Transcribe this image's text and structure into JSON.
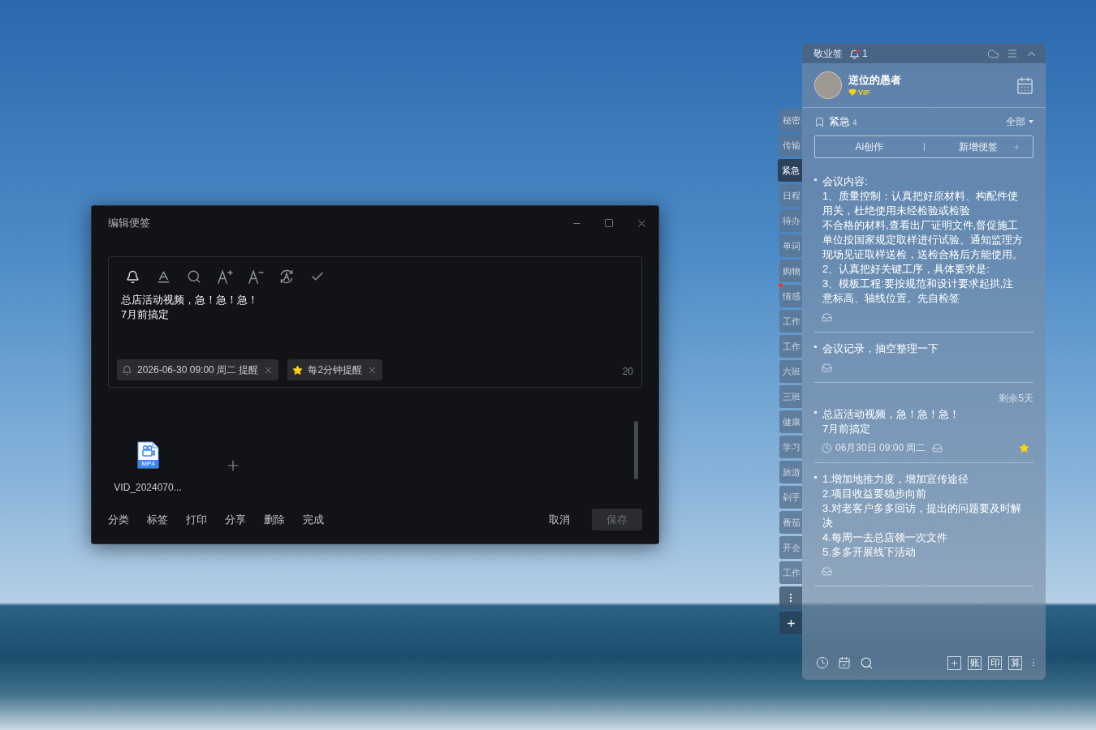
{
  "editor": {
    "title": "编辑便签",
    "content": "总店活动视频，急！急！急！\n7月前搞定",
    "chips": [
      {
        "kind": "reminder",
        "label": "2026-06-30 09:00 周二 提醒"
      },
      {
        "kind": "repeat",
        "label": "每2分钟提醒"
      }
    ],
    "char_count": "20",
    "attachments": [
      {
        "type": "MP4",
        "name": "VID_2024070..."
      }
    ],
    "actions": [
      "分类",
      "标签",
      "打印",
      "分享",
      "删除",
      "完成"
    ],
    "cancel": "取消",
    "save": {
      "label": "保存",
      "disabled": true
    }
  },
  "category_tabs": [
    {
      "label": "秘密",
      "selected": false,
      "alert": false
    },
    {
      "label": "传输",
      "selected": false,
      "alert": false
    },
    {
      "label": "紧急",
      "selected": true,
      "alert": false
    },
    {
      "label": "日程",
      "selected": false,
      "alert": false
    },
    {
      "label": "待办",
      "selected": false,
      "alert": false
    },
    {
      "label": "单词",
      "selected": false,
      "alert": false
    },
    {
      "label": "购物",
      "selected": false,
      "alert": false
    },
    {
      "label": "情感",
      "selected": false,
      "alert": true
    },
    {
      "label": "工作",
      "selected": false,
      "alert": false
    },
    {
      "label": "工作",
      "selected": false,
      "alert": false
    },
    {
      "label": "六班",
      "selected": false,
      "alert": false
    },
    {
      "label": "三班",
      "selected": false,
      "alert": false
    },
    {
      "label": "健康",
      "selected": false,
      "alert": false
    },
    {
      "label": "学习",
      "selected": false,
      "alert": false
    },
    {
      "label": "旅游",
      "selected": false,
      "alert": false
    },
    {
      "label": "剁手",
      "selected": false,
      "alert": false
    },
    {
      "label": "番茄",
      "selected": false,
      "alert": false
    },
    {
      "label": "开会",
      "selected": false,
      "alert": false
    },
    {
      "label": "工作",
      "selected": false,
      "alert": false
    }
  ],
  "notes_panel": {
    "app_name": "敬业签",
    "notification_count": "1",
    "user": {
      "name": "逆位的愚者",
      "badge": "VIP"
    },
    "category": {
      "name": "紧急",
      "count": "4",
      "filter": "全部"
    },
    "buttons": [
      "Ai创作",
      "新增便签"
    ],
    "notes": [
      {
        "lines": [
          "会议内容:",
          "1、质量控制：认真把好原材料、构配件使用关，杜绝使用未经检验或检验",
          "不合格的材料,查看出厂证明文件,督促施工单位按国家规定取样进行试验。通知监理方现场见证取样送检，送检合格后方能使用。",
          "2、认真把好关键工序，具体要求是:",
          "3、模板工程:要按规范和设计要求起拱,注意标高、轴线位置。先自检签"
        ],
        "starred": false
      },
      {
        "lines": [
          "会议记录，抽空整理一下"
        ],
        "starred": false
      },
      {
        "remaining": "剩余5天",
        "lines": [
          "总店活动视频，急！急！急！",
          "7月前搞定"
        ],
        "due": "06月30日 09:00 周二",
        "starred": true
      },
      {
        "lines": [
          "1.增加地推力度，增加宣传途径",
          "2.项目收益要稳步向前",
          "3.对老客户多多回访，提出的问题要及时解决",
          "4.每周一去总店领一次文件",
          "5.多多开展线下活动"
        ],
        "starred": false
      }
    ],
    "tools": [
      "账",
      "印",
      "算"
    ]
  }
}
